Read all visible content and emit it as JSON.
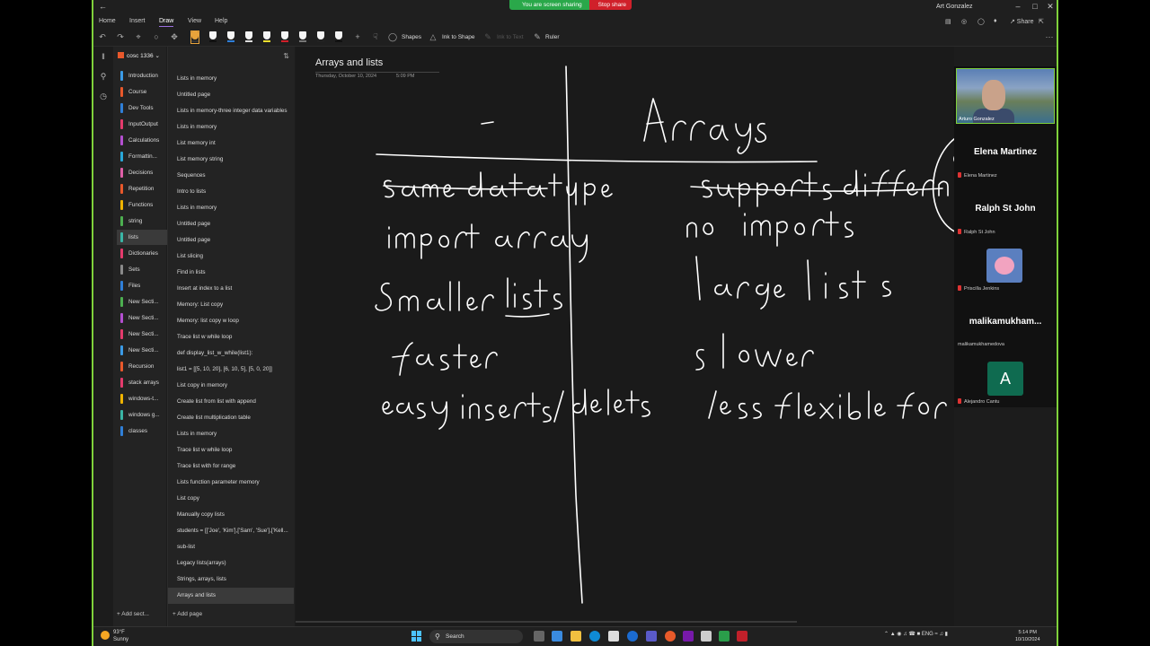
{
  "sharing": {
    "message": "You are screen sharing",
    "stop_label": "Stop share"
  },
  "window": {
    "user": "Art Gonzalez"
  },
  "ribbon": {
    "tabs": [
      "Home",
      "Insert",
      "Draw",
      "View",
      "Help"
    ],
    "active_tab": "Draw"
  },
  "toolbar": {
    "shapes": "Shapes",
    "ink_to_shape": "Ink to Shape",
    "ink_to_text": "Ink to Text",
    "ruler": "Ruler"
  },
  "notebook": {
    "name": "cosc 1336",
    "sections": [
      {
        "label": "Introduction",
        "color": "#3b9be6"
      },
      {
        "label": "Course",
        "color": "#e8582b"
      },
      {
        "label": "Dev Tools",
        "color": "#2f7fd8"
      },
      {
        "label": "InputOutput",
        "color": "#e43b6c"
      },
      {
        "label": "Calculations",
        "color": "#b44fd1"
      },
      {
        "label": "Formattin...",
        "color": "#29a8d9"
      },
      {
        "label": "Decisions",
        "color": "#e05fa7"
      },
      {
        "label": "Repetition",
        "color": "#e8582b"
      },
      {
        "label": "Functions",
        "color": "#f0b400"
      },
      {
        "label": "string",
        "color": "#4caf50"
      },
      {
        "label": "lists",
        "color": "#3ab6a6"
      },
      {
        "label": "Dictionaries",
        "color": "#e43b6c"
      },
      {
        "label": "Sets",
        "color": "#8a8a8a"
      },
      {
        "label": "Files",
        "color": "#2f7fd8"
      },
      {
        "label": "New Secti...",
        "color": "#4caf50"
      },
      {
        "label": "New Secti...",
        "color": "#b44fd1"
      },
      {
        "label": "New Secti...",
        "color": "#e43b6c"
      },
      {
        "label": "New Secti...",
        "color": "#3b9be6"
      },
      {
        "label": "Recursion",
        "color": "#e8582b"
      },
      {
        "label": "stack arrays",
        "color": "#e43b6c"
      },
      {
        "label": "windows-t...",
        "color": "#f0b400"
      },
      {
        "label": "windows g...",
        "color": "#3ab6a6"
      },
      {
        "label": "classes",
        "color": "#2f7fd8"
      }
    ],
    "active_section": 10,
    "add_section": "Add sect..."
  },
  "pages": {
    "items": [
      "Lists in memory",
      "Untitled page",
      "Lists in memory-three integer data variables",
      "Lists in memory",
      "List memory int",
      "List memory string",
      "Sequences",
      "Intro to lists",
      "Lists in memory",
      "Untitled page",
      "Untitled page",
      "List slicing",
      "Find in lists",
      "Insert at index to a list",
      "Memory: List copy",
      "Memory: list copy w loop",
      "Trace list w while loop",
      "def display_list_w_while(list1):",
      "list1 = [[5, 10, 20], [6, 10, 5], [5, 0, 20]]",
      "List copy in memory",
      "Create list from list with append",
      "Create list multiplication table",
      "Lists in memory",
      "Trace list w while loop",
      "Trace list with for range",
      "Lists function parameter memory",
      "List copy",
      "Manually copy lists",
      "students = [['Joe', 'Kim'],['Sam', 'Sue'],['Kell...",
      "sub-list",
      "Legacy lists(arrays)",
      "Strings, arrays, lists",
      "Arrays and lists"
    ],
    "active_index": 32,
    "add_page": "Add page"
  },
  "page": {
    "title": "Arrays and lists",
    "date": "Thursday, October 10, 2024",
    "time": "5:09 PM"
  },
  "meeting": {
    "self_name": "Arturo Gonzalez",
    "participants": [
      {
        "big": "Elena Martinez",
        "small": "Elena Martinez"
      },
      {
        "big": "Ralph St John",
        "small": "Ralph St John"
      },
      {
        "small": "Priscilla Jenkins"
      },
      {
        "big": "malikamukham...",
        "small": "malikamukhamedova"
      },
      {
        "small": "Alejandro Cantu",
        "initial": "A"
      }
    ]
  },
  "taskbar": {
    "weather_temp": "93°F",
    "weather_desc": "Sunny",
    "search": "Search",
    "lang": "ENG",
    "time": "5:14 PM",
    "date": "10/10/2024"
  },
  "colors": {
    "accent_border": "#7fd13b",
    "share_green": "#2aa84a",
    "stop_red": "#d0202a",
    "ink": "#ffffff"
  }
}
